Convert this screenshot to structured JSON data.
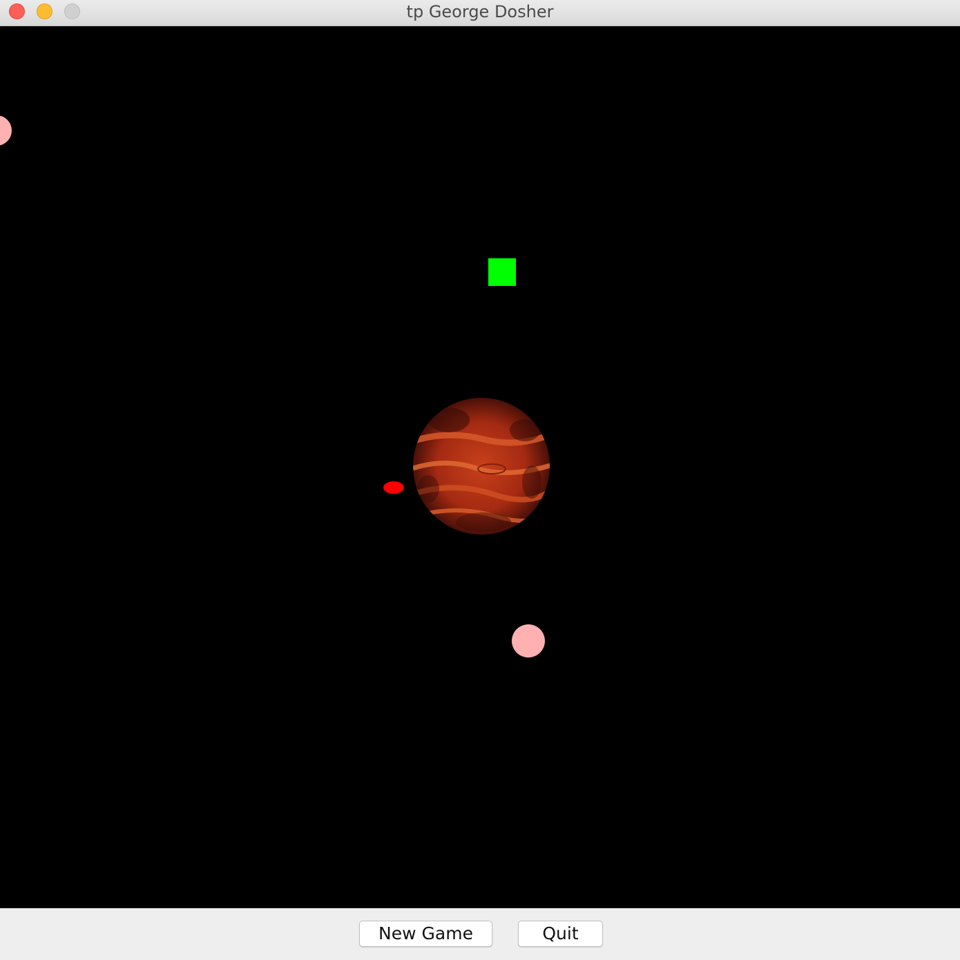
{
  "window": {
    "title": "tp George Dosher",
    "controls": [
      "close",
      "minimize",
      "maximize"
    ]
  },
  "game": {
    "background_color": "#000000",
    "player_color": "#00ff00",
    "planet_color": "#b52a12",
    "enemy_color": "#ff0000",
    "moon_color": "#ffb0b0"
  },
  "buttons": {
    "new_game_label": "New Game",
    "quit_label": "Quit"
  }
}
